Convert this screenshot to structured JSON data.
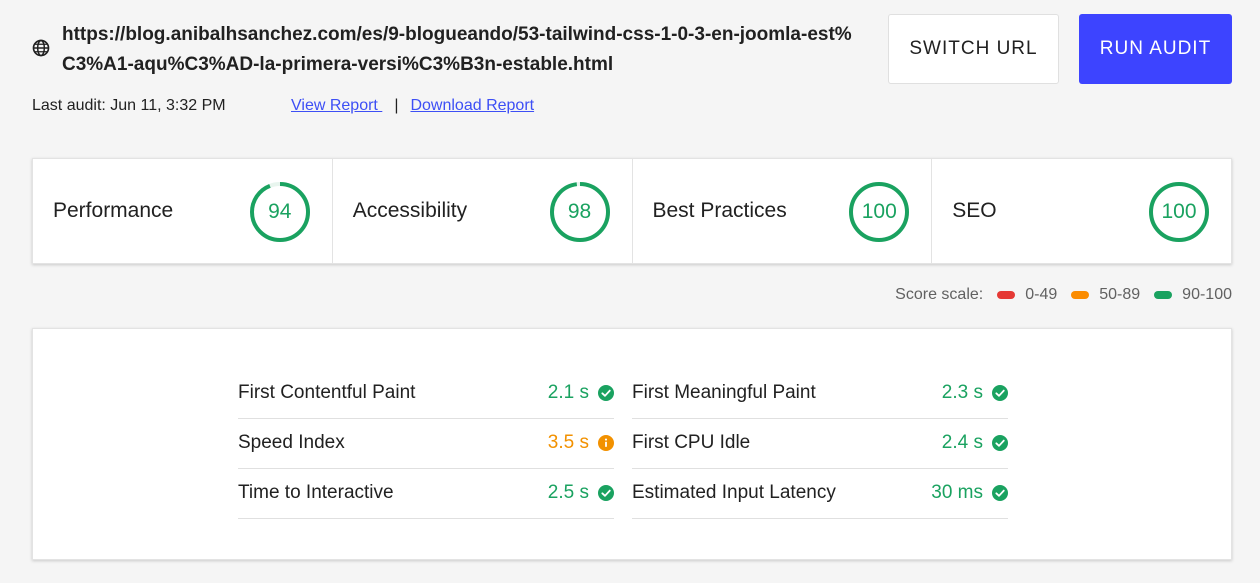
{
  "header": {
    "url": "https://blog.anibalhsanchez.com/es/9-blogueando/53-tailwind-css-1-0-3-en-joomla-est%C3%A1-aqu%C3%AD-la-primera-versi%C3%B3n-estable.html",
    "last_audit": "Last audit: Jun 11, 3:32 PM",
    "view_report": "View Report ",
    "separator": "|",
    "download_report": "Download Report",
    "switch_url": "SWITCH URL",
    "run_audit": "RUN AUDIT"
  },
  "scores": [
    {
      "label": "Performance",
      "value": "94",
      "fraction": 0.94
    },
    {
      "label": "Accessibility",
      "value": "98",
      "fraction": 0.98
    },
    {
      "label": "Best Practices",
      "value": "100",
      "fraction": 1.0
    },
    {
      "label": "SEO",
      "value": "100",
      "fraction": 1.0
    }
  ],
  "legend": {
    "title": "Score scale:",
    "items": [
      {
        "label": "0-49",
        "color": "#e53935"
      },
      {
        "label": "50-89",
        "color": "#fb8c00"
      },
      {
        "label": "90-100",
        "color": "#1aa260"
      }
    ]
  },
  "metrics": {
    "left": [
      {
        "name": "First Contentful Paint",
        "value": "2.1 s",
        "status": "pass"
      },
      {
        "name": "Speed Index",
        "value": "3.5 s",
        "status": "average"
      },
      {
        "name": "Time to Interactive",
        "value": "2.5 s",
        "status": "pass"
      }
    ],
    "right": [
      {
        "name": "First Meaningful Paint",
        "value": "2.3 s",
        "status": "pass"
      },
      {
        "name": "First CPU Idle",
        "value": "2.4 s",
        "status": "pass"
      },
      {
        "name": "Estimated Input Latency",
        "value": "30 ms",
        "status": "pass"
      }
    ]
  },
  "colors": {
    "pass": "#1aa260",
    "average": "#f29100",
    "accent": "#3d44ff"
  }
}
